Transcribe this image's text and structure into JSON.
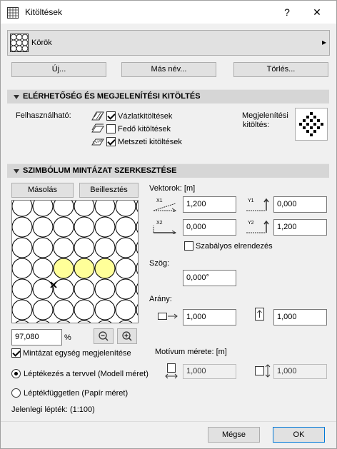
{
  "window": {
    "title": "Kitöltések",
    "help": "?",
    "close": "✕"
  },
  "selector": {
    "value": "Körök",
    "arrow": "▸"
  },
  "actions": {
    "new": "Új...",
    "rename": "Más név...",
    "delete": "Törlés..."
  },
  "availability": {
    "header": "ELÉRHETŐSÉG ÉS MEGJELENÍTÉSI KITÖLTÉS",
    "usable_label": "Felhasználható:",
    "options": [
      {
        "label": "Vázlatkitöltések",
        "checked": true,
        "icon": "drafting-fill-icon"
      },
      {
        "label": "Fedő kitöltések",
        "checked": false,
        "icon": "cover-fill-icon"
      },
      {
        "label": "Metszeti kitöltések",
        "checked": true,
        "icon": "cut-fill-icon"
      }
    ],
    "display_label_1": "Megjelenítési",
    "display_label_2": "kitöltés:"
  },
  "symbol": {
    "header": "SZIMBÓLUM MINTÁZAT SZERKESZTÉSE",
    "copy": "Másolás",
    "paste": "Beillesztés",
    "zoom_value": "97,080",
    "zoom_unit": "%",
    "show_unit_label": "Mintázat egység megjelenítése",
    "show_unit_checked": true,
    "vectors_label": "Vektorok: [m]",
    "x1": "1,200",
    "y1": "0,000",
    "x2": "0,000",
    "y2": "1,200",
    "regular_label": "Szabályos elrendezés",
    "regular_checked": false,
    "angle_label": "Szög:",
    "angle_value": "0,000°",
    "ratio_label": "Arány:",
    "ratio_x": "1,000",
    "ratio_y": "1,000",
    "motif_label": "Motívum mérete: [m]",
    "motif_x": "1,000",
    "motif_y": "1,000",
    "scale_model_label": "Léptékezés a tervvel (Modell méret)",
    "scale_paper_label": "Léptékfüggetlen (Papír méret)",
    "scale_model_selected": true,
    "current_scale": "Jelenlegi lépték: (1:100)"
  },
  "footer": {
    "cancel": "Mégse",
    "ok": "OK"
  },
  "colors": {
    "highlight": "#ffff99",
    "section_bg": "#d6d6d6"
  }
}
